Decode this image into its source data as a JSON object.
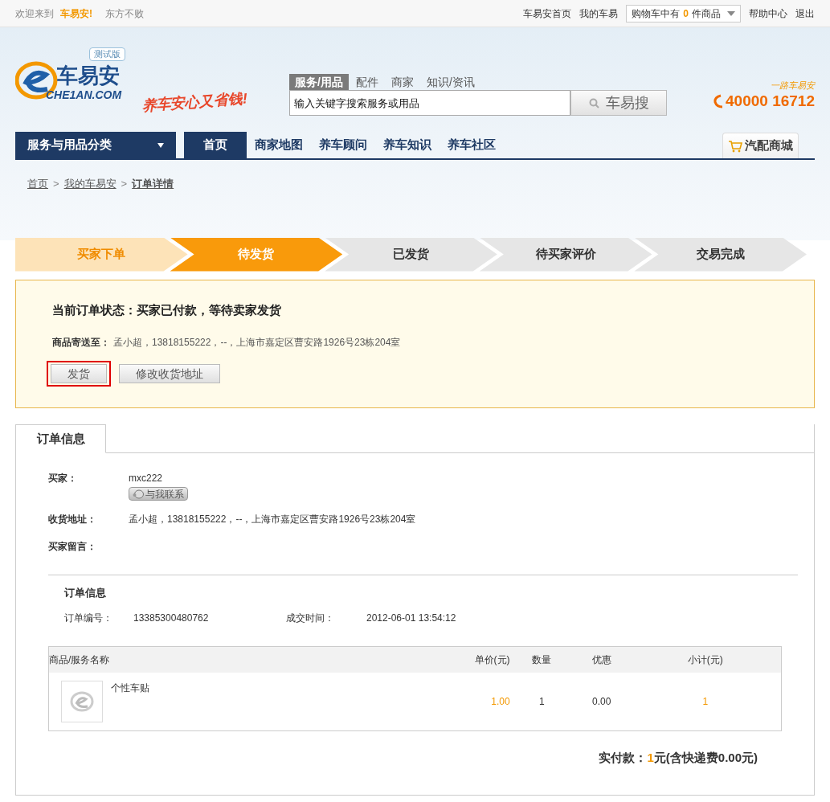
{
  "top_bar": {
    "welcome": "欢迎来到",
    "brand": "车易安!",
    "user": "东方不败",
    "links": [
      "车易安首页",
      "我的车易"
    ],
    "cart": {
      "prefix": "购物车中有",
      "count": "0",
      "suffix": "件商品"
    },
    "links_right": [
      "帮助中心",
      "退出"
    ]
  },
  "header": {
    "beta_badge": "测试版",
    "logo_text": "车易安",
    "logo_domain": "CHE1AN.COM",
    "slogan": "养车安心又省钱!",
    "search_tabs": [
      {
        "label": "服务/用品",
        "selected": true
      },
      {
        "label": "配件",
        "selected": false
      },
      {
        "label": "商家",
        "selected": false
      },
      {
        "label": "知识/资讯",
        "selected": false
      }
    ],
    "search": {
      "placeholder": "输入关键字搜索服务或用品",
      "button": "车易搜"
    },
    "hotline": {
      "caption": "一路车易安",
      "number": "40000 16712"
    }
  },
  "nav": {
    "category": "服务与用品分类",
    "items": [
      {
        "label": "首页",
        "selected": true
      },
      {
        "label": "商家地图",
        "selected": false
      },
      {
        "label": "养车顾问",
        "selected": false
      },
      {
        "label": "养车知识",
        "selected": false
      },
      {
        "label": "养车社区",
        "selected": false
      }
    ],
    "mall": "汽配商城"
  },
  "breadcrumb": [
    {
      "label": "首页",
      "kind": "link"
    },
    {
      "label": ">",
      "kind": "sep"
    },
    {
      "label": "我的车易安",
      "kind": "link"
    },
    {
      "label": ">",
      "kind": "sep"
    },
    {
      "label": "订单详情",
      "kind": "current"
    }
  ],
  "steps": [
    {
      "label": "买家下单",
      "kind": "done"
    },
    {
      "label": "待发货",
      "kind": "current"
    },
    {
      "label": "已发货",
      "kind": "todo"
    },
    {
      "label": "待买家评价",
      "kind": "todo"
    },
    {
      "label": "交易完成",
      "kind": "todo"
    }
  ],
  "status_box": {
    "title": "当前订单状态：买家已付款，等待卖家发货",
    "ship_label": "商品寄送至：",
    "ship_value": "孟小超，13818155222，--，上海市嘉定区曹安路1926号23栋204室",
    "buttons": [
      {
        "label": "发货",
        "highlighted": true
      },
      {
        "label": "修改收货地址",
        "highlighted": false
      }
    ]
  },
  "order_tabs": [
    {
      "label": "订单信息",
      "selected": true
    }
  ],
  "buyer": {
    "label": "买家：",
    "value": "mxc222",
    "contact": "与我联系"
  },
  "address": {
    "label": "收货地址：",
    "value": "孟小超，13818155222，--，上海市嘉定区曹安路1926号23栋204室"
  },
  "message": {
    "label": "买家留言："
  },
  "order_info": {
    "title": "订单信息",
    "number_label": "订单编号：",
    "number": "13385300480762",
    "time_label": "成交时间：",
    "time": "2012-06-01 13:54:12"
  },
  "table": {
    "columns": [
      "商品/服务名称",
      "单价(元)",
      "数量",
      "优惠",
      "小计(元)"
    ],
    "rows": [
      {
        "name": "个性车贴",
        "price": "1.00",
        "qty": "1",
        "discount": "0.00",
        "subtotal": "1"
      }
    ]
  },
  "total": {
    "label": "实付款：",
    "amount": "1",
    "suffix": "元(含快递费0.00元)"
  }
}
